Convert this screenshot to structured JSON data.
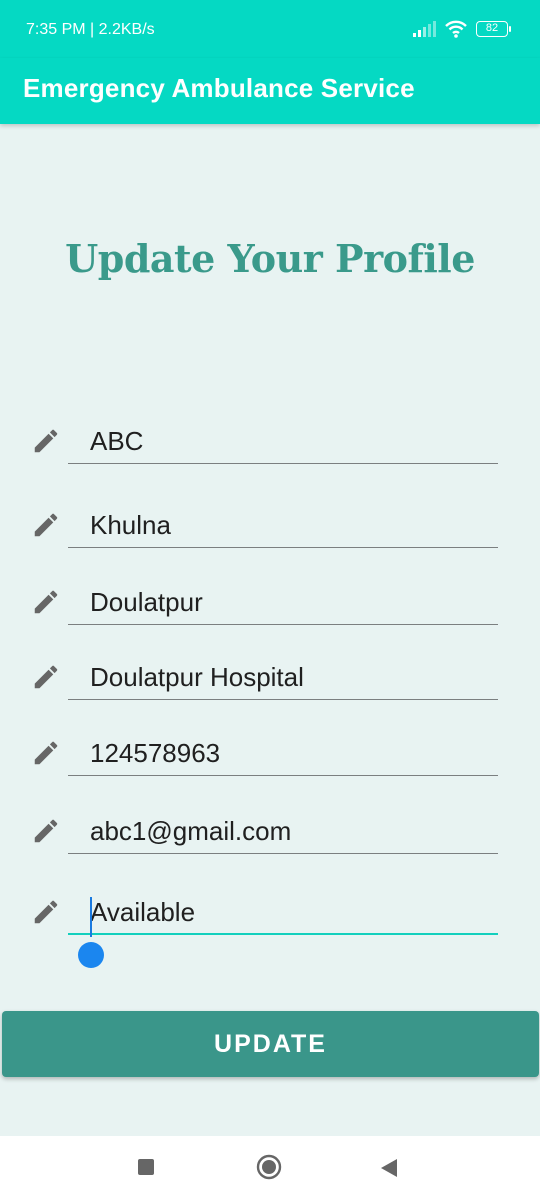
{
  "status_bar": {
    "time": "7:35 PM | 2.2KB/s",
    "battery": "82"
  },
  "app_bar": {
    "title": "Emergency Ambulance Service"
  },
  "page": {
    "title": "Update Your Profile"
  },
  "fields": [
    {
      "value": "ABC",
      "icon": "pencil-icon"
    },
    {
      "value": "Khulna",
      "icon": "pencil-icon"
    },
    {
      "value": "Doulatpur",
      "icon": "pencil-icon"
    },
    {
      "value": "Doulatpur Hospital",
      "icon": "pencil-icon"
    },
    {
      "value": "124578963",
      "icon": "pencil-icon"
    },
    {
      "value": "abc1@gmail.com",
      "icon": "pencil-icon"
    },
    {
      "value": "Available",
      "icon": "pencil-icon",
      "focused": true
    }
  ],
  "update_button": {
    "label": "UPDATE"
  },
  "colors": {
    "app_bar": "#05d9c3",
    "title": "#3a9a8b",
    "button": "#3a968a",
    "background": "#e8f3f2",
    "focus_line": "#13cfbd",
    "cursor": "#1b86ef"
  },
  "nav_bar": {
    "icons": [
      "recents-icon",
      "home-icon",
      "back-icon"
    ]
  }
}
